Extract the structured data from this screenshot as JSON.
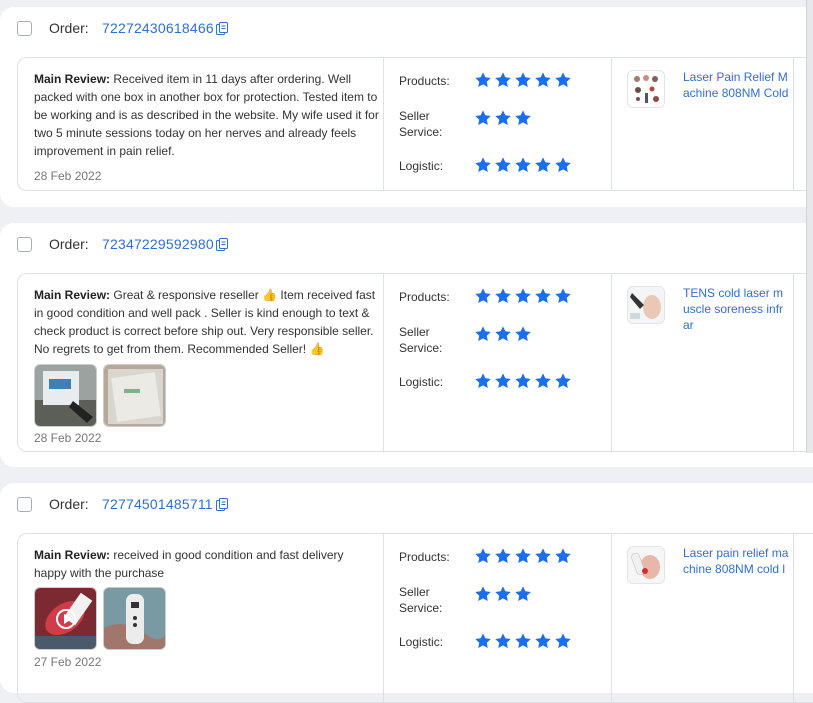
{
  "order_label": "Order:",
  "labels": {
    "main_review": "Main Review:",
    "products": "Products:",
    "seller_service": "Seller Service:",
    "logistic": "Logistic:"
  },
  "colors": {
    "star": "#1a6ef0",
    "link": "#2e6fd8"
  },
  "orders": [
    {
      "order_number": "72272430618466",
      "review_text": "Received item in 11 days after ordering. Well packed with one box in another box for protection. Tested item to be working and is as described in the website. My wife used it for two 5 minute sessions today on her nerves and already feels improvement in pain relief.",
      "date": "28 Feb 2022",
      "ratings": {
        "products": 5,
        "seller_service": 3,
        "logistic": 5
      },
      "product_name": "Laser Pain Relief Machine 808NM Cold",
      "photos": []
    },
    {
      "order_number": "72347229592980",
      "review_text_1": "Great & responsive reseller",
      "review_text_2": "Item received fast in good condition and well pack . Seller is kind enough to text & check product is correct before ship out. Very responsible seller. No regrets to get from them. Recommended Seller!",
      "date": "28 Feb 2022",
      "ratings": {
        "products": 5,
        "seller_service": 3,
        "logistic": 5
      },
      "product_name": "TENS cold laser muscle soreness infrar",
      "photos": [
        "photo",
        "photo"
      ]
    },
    {
      "order_number": "72774501485711",
      "review_text": "received in good condition and fast delivery happy with the purchase",
      "date": "27 Feb 2022",
      "ratings": {
        "products": 5,
        "seller_service": 3,
        "logistic": 5
      },
      "product_name": "Laser pain relief machine 808NM cold l",
      "photos": [
        "video",
        "photo"
      ]
    }
  ]
}
